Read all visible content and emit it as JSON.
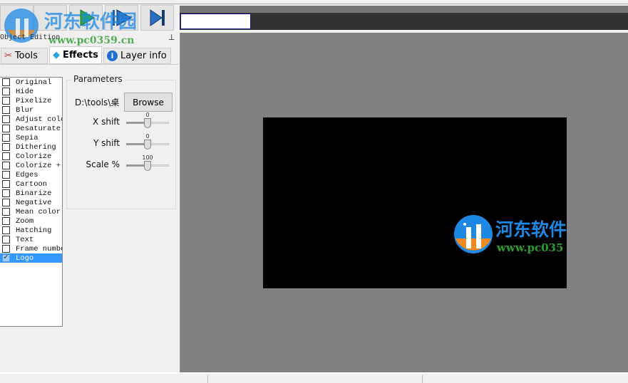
{
  "toolbar": {
    "buttons": [
      {
        "name": "blank-button",
        "icon": "none"
      },
      {
        "name": "blank-button-2",
        "icon": "none"
      },
      {
        "name": "play-button",
        "icon": "play-icon",
        "color": "#2aa84a"
      },
      {
        "name": "play-pause-button",
        "icon": "play-bar-icon",
        "color": "#2060a8"
      },
      {
        "name": "skip-end-button",
        "icon": "skip-end-icon",
        "color": "#2060a8"
      }
    ]
  },
  "panel": {
    "title": "Object Edition",
    "pin_icon": "pin-icon",
    "tabs": [
      {
        "label": "Tools",
        "icon": "tools-icon"
      },
      {
        "label": "Effects",
        "icon": "diamond-icon",
        "active": true
      },
      {
        "label": "Layer info",
        "icon": "info-icon"
      }
    ]
  },
  "effects": [
    {
      "label": "Original",
      "checked": false
    },
    {
      "label": "Hide",
      "checked": false
    },
    {
      "label": "Pixelize",
      "checked": false
    },
    {
      "label": "Blur",
      "checked": false
    },
    {
      "label": "Adjust colo",
      "checked": false
    },
    {
      "label": "Desaturate",
      "checked": false
    },
    {
      "label": "Sepia",
      "checked": false
    },
    {
      "label": "Dithering",
      "checked": false
    },
    {
      "label": "Colorize",
      "checked": false
    },
    {
      "label": "Colorize +",
      "checked": false
    },
    {
      "label": "Edges",
      "checked": false
    },
    {
      "label": "Cartoon",
      "checked": false
    },
    {
      "label": "Binarize",
      "checked": false
    },
    {
      "label": "Negative",
      "checked": false
    },
    {
      "label": "Mean color",
      "checked": false
    },
    {
      "label": "Zoom",
      "checked": false
    },
    {
      "label": "Hatching",
      "checked": false
    },
    {
      "label": "Text",
      "checked": false
    },
    {
      "label": "Frame numbe",
      "checked": false
    },
    {
      "label": "Logo",
      "checked": true,
      "selected": true
    }
  ],
  "parameters": {
    "title": "Parameters",
    "path": "D:\\tools\\桌",
    "browse_label": "Browse",
    "sliders": [
      {
        "label": "X shift",
        "value": "0",
        "fraction": 0.5
      },
      {
        "label": "Y shift",
        "value": "0",
        "fraction": 0.5
      },
      {
        "label": "Scale %",
        "value": "100",
        "fraction": 0.5
      }
    ]
  },
  "watermark": {
    "title": "河东软件园",
    "url": "www.pc0359.cn",
    "preview_title": "河东软件",
    "preview_url": "www.pc035"
  },
  "colors": {
    "accent": "#3399ff",
    "preview_bg": "#808080",
    "frame": "#000000",
    "logo_blue": "#1e88e5",
    "logo_green": "#2e9e2e",
    "logo_orange": "#f08a1c"
  }
}
